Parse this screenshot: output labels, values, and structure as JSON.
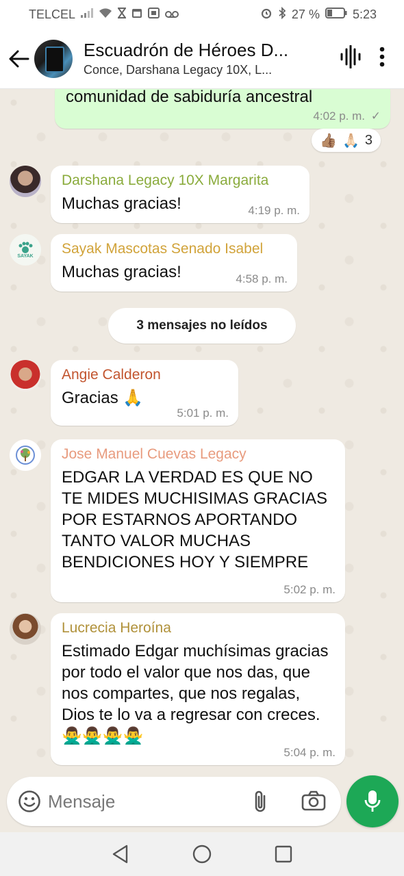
{
  "status_bar": {
    "carrier": "TELCEL",
    "battery_percent": "27 %",
    "time": "5:23",
    "left_icons": [
      "signal-icon",
      "wifi-icon",
      "hourglass-icon",
      "calendar-icon",
      "calendar-31-icon",
      "voicemail-icon"
    ],
    "right_icons": [
      "alarm-icon",
      "bluetooth-icon",
      "battery-icon"
    ]
  },
  "header": {
    "title": "Escuadrón de Héroes D...",
    "subtitle": "Conce, Darshana Legacy 10X, L...",
    "icons": [
      "back-arrow-icon",
      "audio-call-icon",
      "more-options-icon"
    ]
  },
  "chat": {
    "top_message": {
      "text": "comunidad de sabiduría ancestral",
      "time": "4:02 p. m.",
      "status": "✓",
      "reactions": [
        "👍🏽",
        "🙏🏻"
      ],
      "reaction_count": "3"
    },
    "messages": [
      {
        "sender": "Darshana Legacy 10X Margarita",
        "sender_color": "#8aab3c",
        "text": "Muchas gracias!",
        "time": "4:19 p. m."
      },
      {
        "sender": "Sayak Mascotas Senado Isabel",
        "sender_color": "#d1a33a",
        "text": "Muchas gracias!",
        "time": "4:58 p. m.",
        "avatar_text": "SAYAK"
      },
      {
        "sender": "Angie Calderon",
        "sender_color": "#c2552f",
        "text": "Gracias 🙏",
        "time": "5:01 p. m."
      },
      {
        "sender": "Jose Manuel Cuevas Legacy",
        "sender_color": "#e89b7e",
        "text": "EDGAR LA VERDAD ES QUE NO TE MIDES MUCHISIMAS GRACIAS POR ESTARNOS APORTANDO TANTO VALOR MUCHAS BENDICIONES HOY Y SIEMPRE",
        "time": "5:02 p. m."
      },
      {
        "sender": "Lucrecia Heroína",
        "sender_color": "#b0913a",
        "text": "Estimado Edgar muchísimas gracias por todo el valor que nos das, que nos compartes, que nos regalas, Dios te lo va a regresar con creces.🙅‍♂️🙅‍♂️🙅‍♂️🙅‍♂️",
        "time": "5:04 p. m."
      }
    ],
    "unread_label": "3 mensajes no leídos"
  },
  "composer": {
    "placeholder": "Mensaje",
    "icons": [
      "emoji-icon",
      "attach-icon",
      "camera-icon",
      "mic-icon"
    ]
  },
  "nav_bar": {
    "icons": [
      "nav-back-icon",
      "nav-home-icon",
      "nav-recents-icon"
    ]
  },
  "colors": {
    "accent_green": "#1da856",
    "outgoing_bubble": "#d9fdd3",
    "chat_background": "#efeae2"
  }
}
